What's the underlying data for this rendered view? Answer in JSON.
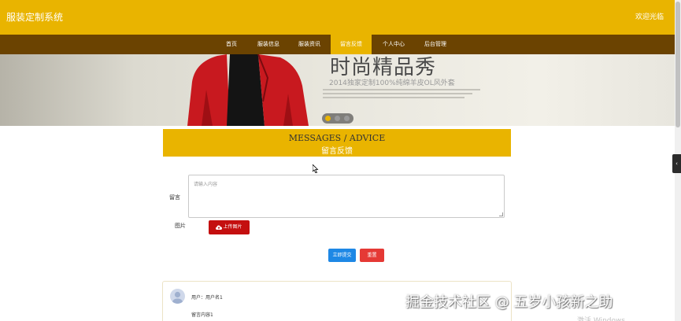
{
  "header": {
    "brand": "服装定制系统",
    "welcome": "欢迎光临"
  },
  "nav": {
    "items": [
      {
        "label": "首页",
        "active": false
      },
      {
        "label": "服装信息",
        "active": false
      },
      {
        "label": "服装资讯",
        "active": false
      },
      {
        "label": "留言反馈",
        "active": true
      },
      {
        "label": "个人中心",
        "active": false
      },
      {
        "label": "后台管理",
        "active": false
      }
    ]
  },
  "banner": {
    "title": "时尚精品秀",
    "subtitle": "2014独家定制100%纯绵羊皮OL风外套",
    "active_slide": 1,
    "slide_count": 3
  },
  "section": {
    "title_en": "MESSAGES / ADVICE",
    "title_cn": "留言反馈"
  },
  "form": {
    "message_label": "留言",
    "message_placeholder": "请输入内容",
    "image_label": "图片",
    "upload_label": "上传图片",
    "submit_label": "立即提交",
    "reset_label": "重置"
  },
  "comments": [
    {
      "user": "用户：用户名1",
      "content": "留言内容1"
    }
  ],
  "watermark": {
    "juejin": "掘金技术社区 @ 五岁小孩新之助",
    "windows": "激活 Windows"
  },
  "colors": {
    "accent": "#e9b400",
    "nav_bg": "#6b4301",
    "upload": "#c40f0f",
    "submit": "#1e88e5",
    "reset": "#e53935"
  },
  "icons": {
    "upload": "cloud-upload-icon",
    "avatar": "user-avatar-icon",
    "side_tab": "chevron-left-icon"
  }
}
